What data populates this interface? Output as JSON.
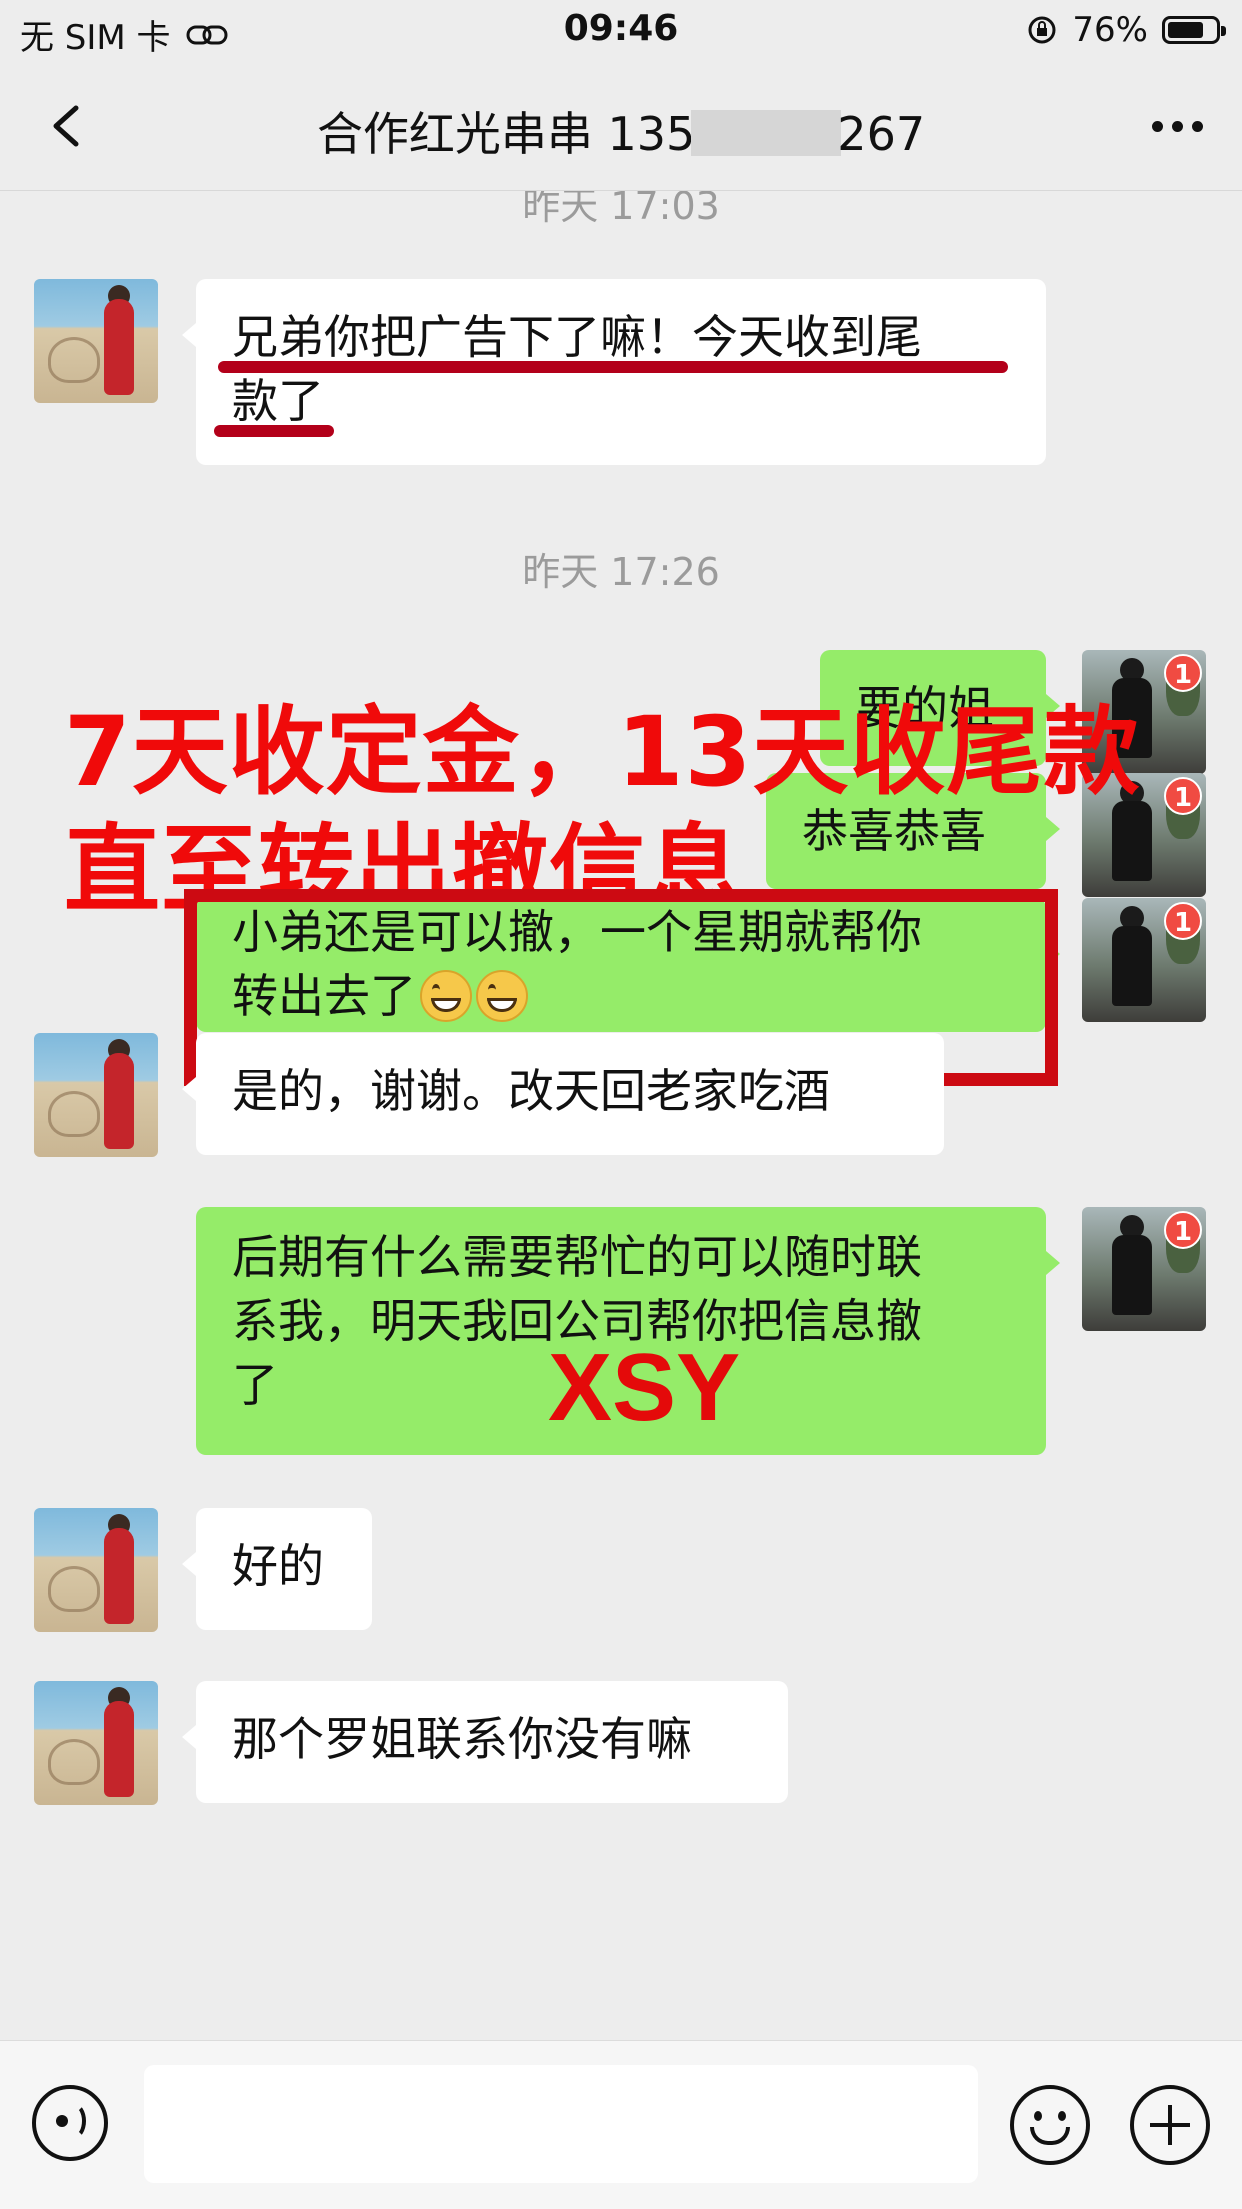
{
  "status_bar": {
    "carrier": "无 SIM 卡",
    "time": "09:46",
    "battery": "76%",
    "battery_level": 0.76
  },
  "nav": {
    "title_prefix": "合作红光串串 135",
    "title_suffix": "267",
    "back_icon": "chevron-left-icon",
    "more_icon": "more-dots-icon"
  },
  "timestamps": [
    "昨天 17:03",
    "昨天 17:26"
  ],
  "messages": [
    {
      "side": "in",
      "lines": [
        "兄弟你把广告下了嘛！今天收到尾",
        "款了"
      ]
    },
    {
      "side": "out",
      "text": "要的姐",
      "badge": "1"
    },
    {
      "side": "out",
      "text": "恭喜恭喜",
      "badge": "1"
    },
    {
      "side": "out",
      "lines": [
        "小弟还是可以撤，一个星期就帮你",
        "转出去了"
      ],
      "badge": "1"
    },
    {
      "side": "in",
      "text": "是的，谢谢。改天回老家吃酒"
    },
    {
      "side": "out",
      "lines": [
        "后期有什么需要帮忙的可以随时联",
        "系我，明天我回公司帮你把信息撤",
        "了"
      ],
      "badge": "1"
    },
    {
      "side": "in",
      "text": "好的"
    },
    {
      "side": "in",
      "text": "那个罗姐联系你没有嘛"
    }
  ],
  "overlay": {
    "line1": "7天收定金，13天收尾款",
    "line2": "直至转出撤信息",
    "watermark": "XSY",
    "accent_color": "#f00a0a"
  },
  "input_bar": {
    "voice_icon": "voice-icon",
    "emoji_icon": "emoji-icon",
    "plus_icon": "plus-icon"
  }
}
